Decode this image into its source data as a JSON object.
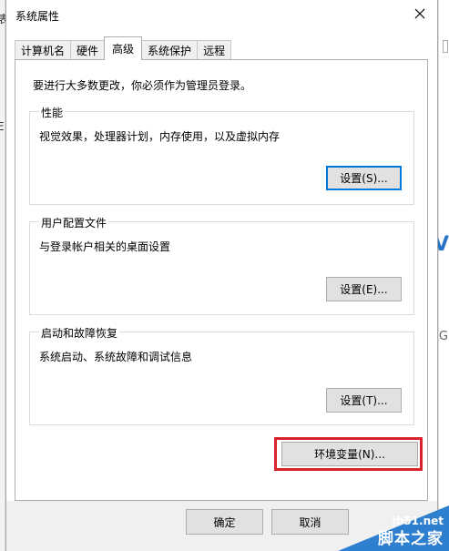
{
  "background": {
    "left_glyph": "表",
    "left_glyph2": "E",
    "right_mark1": "V",
    "right_mark2": "G"
  },
  "window": {
    "title": "系统属性",
    "close_icon": "close-icon"
  },
  "tabs": [
    {
      "label": "计算机名",
      "active": false
    },
    {
      "label": "硬件",
      "active": false
    },
    {
      "label": "高级",
      "active": true
    },
    {
      "label": "系统保护",
      "active": false
    },
    {
      "label": "远程",
      "active": false
    }
  ],
  "advanced": {
    "intro": "要进行大多数更改，你必须作为管理员登录。",
    "performance": {
      "legend": "性能",
      "description": "视觉效果，处理器计划，内存使用，以及虚拟内存",
      "button": "设置(S)..."
    },
    "user_profiles": {
      "legend": "用户配置文件",
      "description": "与登录帐户相关的桌面设置",
      "button": "设置(E)..."
    },
    "startup_recovery": {
      "legend": "启动和故障恢复",
      "description": "系统启动、系统故障和调试信息",
      "button": "设置(T)..."
    },
    "env_button": "环境变量(N)...",
    "highlight_color": "#d9222a"
  },
  "footer": {
    "ok": "确定",
    "cancel": "取消"
  },
  "watermark": {
    "site": "jb51.net",
    "name": "脚本之家",
    "color": "#2f7fd0"
  }
}
